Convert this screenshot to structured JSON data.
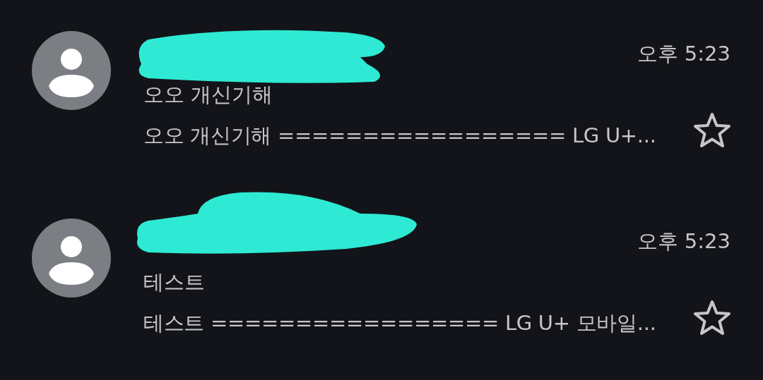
{
  "messages": [
    {
      "time": "오후 5:23",
      "subject": "오오 개신기해",
      "snippet": "오오 개신기해 ================= LG U+...",
      "starred": false
    },
    {
      "time": "오후 5:23",
      "subject": "테스트",
      "snippet": "테스트 ================= LG U+ 모바일...",
      "starred": false
    }
  ]
}
